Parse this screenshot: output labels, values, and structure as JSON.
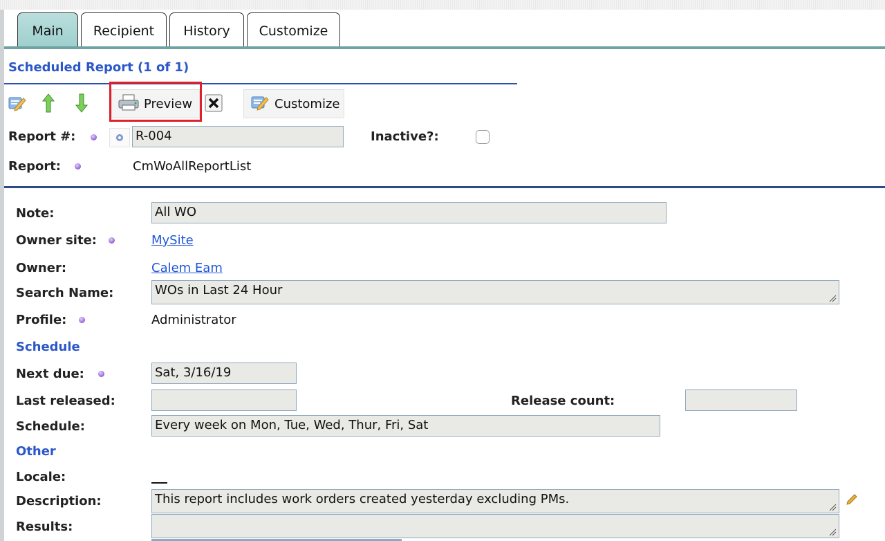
{
  "tabs": [
    "Main",
    "Recipient",
    "History",
    "Customize"
  ],
  "section_title": "Scheduled Report (1 of 1)",
  "toolbar": {
    "preview_label": "Preview",
    "customize_label": "Customize"
  },
  "labels": {
    "report_no": "Report #:",
    "inactive": "Inactive?:",
    "report": "Report:",
    "note": "Note:",
    "owner_site": "Owner site:",
    "owner": "Owner:",
    "search_name": "Search Name:",
    "profile": "Profile:",
    "schedule_heading": "Schedule",
    "next_due": "Next due:",
    "last_released": "Last released:",
    "release_count": "Release count:",
    "schedule": "Schedule:",
    "other_heading": "Other",
    "locale": "Locale:",
    "description": "Description:",
    "results": "Results:"
  },
  "values": {
    "report_no": "R-004",
    "inactive_checked": false,
    "report": "CmWoAllReportList",
    "note": "All WO",
    "owner_site": "MySite",
    "owner": "Calem Eam",
    "search_name": "WOs in Last 24 Hour",
    "profile": "Administrator",
    "next_due": "Sat, 3/16/19",
    "last_released": "",
    "release_count": "",
    "schedule": "Every week on Mon, Tue, Wed, Thur, Fri, Sat",
    "locale": "",
    "description": "This report includes work orders created yesterday excluding PMs.",
    "results": ""
  },
  "colors": {
    "accent": "#2b57c8",
    "link": "#1f55d8",
    "highlight": "#e0202a",
    "tab_active": "#a9d6d4"
  }
}
